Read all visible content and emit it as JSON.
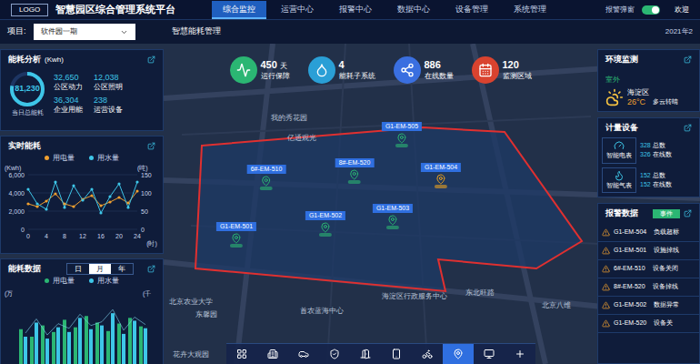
{
  "header": {
    "logo": "LOGO",
    "title": "智慧园区综合管理系统平台",
    "nav": [
      {
        "label": "综合监控",
        "selected": true
      },
      {
        "label": "运营中心",
        "selected": false
      },
      {
        "label": "报警中心",
        "selected": false
      },
      {
        "label": "数据中心",
        "selected": false
      },
      {
        "label": "设备管理",
        "selected": false
      },
      {
        "label": "系统管理",
        "selected": false
      }
    ],
    "alarm_popup": {
      "label": "报警弹窗",
      "on": true
    },
    "welcome": "欢迎"
  },
  "subbar": {
    "project_label": "项目:",
    "project": "软件园一期",
    "section": "智慧能耗管理",
    "date": "2021年2"
  },
  "energy_analysis": {
    "title": "能耗分析",
    "unit": "(Kwh)",
    "total": "81,230",
    "total_label": "当日总能耗",
    "level": 0.78,
    "stats": [
      {
        "value": "32,650",
        "label": "公区动力"
      },
      {
        "value": "12,038",
        "label": "公区照明"
      },
      {
        "value": "36,304",
        "label": "企业用能"
      },
      {
        "value": "238",
        "label": "运营设备"
      }
    ]
  },
  "realtime": {
    "title": "实时能耗",
    "legend": [
      {
        "label": "用电量",
        "color": "#f0a030"
      },
      {
        "label": "用水量",
        "color": "#3ec6e8"
      }
    ],
    "left_unit": "(Kwh)",
    "right_unit": "(吨)",
    "left_ticks": [
      "6,000",
      "4,000",
      "2,000",
      "0"
    ],
    "right_ticks": [
      "150",
      "100",
      "50",
      "0"
    ],
    "x_ticks": [
      "0",
      "4",
      "8",
      "12",
      "16",
      "20",
      "24"
    ],
    "x_unit": "(时)",
    "electricity": [
      2800,
      2500,
      3100,
      3900,
      2800,
      2500,
      3300,
      3700,
      2600,
      3000,
      3500,
      2900,
      4200
    ],
    "water": [
      110,
      70,
      55,
      130,
      60,
      120,
      80,
      110,
      45,
      90,
      125,
      60,
      130
    ]
  },
  "energy_data": {
    "title": "能耗数据",
    "tabs": [
      {
        "label": "日",
        "selected": false
      },
      {
        "label": "月",
        "selected": true
      },
      {
        "label": "年",
        "selected": false
      }
    ],
    "legend": [
      {
        "label": "用电量",
        "color": "#2bb673"
      },
      {
        "label": "用水量",
        "color": "#3ec6e8"
      }
    ],
    "left_unit": "(万",
    "right_unit": "(千",
    "electricity": [
      38,
      30,
      42,
      35,
      48,
      40,
      52,
      45,
      36,
      44,
      50,
      41
    ],
    "water": [
      30,
      45,
      28,
      40,
      35,
      50,
      38,
      42,
      55,
      33,
      47,
      39
    ]
  },
  "stats": [
    {
      "value": "450",
      "unit": "天",
      "label": "运行保障",
      "color": "#2bb673"
    },
    {
      "value": "4",
      "unit": "",
      "label": "能耗子系统",
      "color": "#2a9fd6"
    },
    {
      "value": "886",
      "unit": "",
      "label": "在线数量",
      "color": "#3a6fe0"
    },
    {
      "value": "120",
      "unit": "",
      "label": "监测区域",
      "color": "#d9432f"
    }
  ],
  "map": {
    "labels": [
      "我的秀花园",
      "亿通观光",
      "海淀区行政服务中心",
      "首农蓝海中心",
      "东北旺路",
      "东馨园",
      "北京农业大学",
      "花卉大观园",
      "北京八维"
    ],
    "pins": [
      {
        "label": "G1-EM-505",
        "color": "#2bb673"
      },
      {
        "label": "6#-EM-510",
        "color": "#2bb673"
      },
      {
        "label": "8#-EM-520",
        "color": "#2bb673"
      },
      {
        "label": "G1-EM-504",
        "color": "#e8a020"
      },
      {
        "label": "G1-EM-501",
        "color": "#2bb673"
      },
      {
        "label": "G1-EM-502",
        "color": "#2bb673"
      },
      {
        "label": "G1-EM-503",
        "color": "#2bb673"
      }
    ]
  },
  "toolbar": [
    {
      "selected": false
    },
    {
      "selected": false
    },
    {
      "selected": false
    },
    {
      "selected": false
    },
    {
      "selected": false
    },
    {
      "selected": false
    },
    {
      "selected": false
    },
    {
      "selected": true
    },
    {
      "selected": false
    },
    {
      "selected": false
    }
  ],
  "environment": {
    "title": "环境监测",
    "place": "室外",
    "district": "海淀区",
    "temperature": "26°C",
    "weather": "多云转晴"
  },
  "meters": {
    "title": "计量设备",
    "items": [
      {
        "name": "智能电表",
        "total": "328",
        "total_label": "总数",
        "online": "326",
        "online_label": "在线数"
      },
      {
        "name": "智能气表",
        "total": "152",
        "total_label": "总数",
        "online": "152",
        "online_label": "在线数"
      }
    ]
  },
  "alarms": {
    "title": "报警数据",
    "tab": {
      "label": "事件",
      "selected": true
    },
    "rows": [
      {
        "id": "G1-EM-504",
        "message": "负载超标"
      },
      {
        "id": "G1-EM-501",
        "message": "设施掉线"
      },
      {
        "id": "6#-EM-510",
        "message": "设备关闭"
      },
      {
        "id": "8#-EM-520",
        "message": "设备掉线"
      },
      {
        "id": "G1-EM-502",
        "message": "数据异常"
      },
      {
        "id": "G1-EM-520",
        "message": "设备关"
      }
    ]
  }
}
